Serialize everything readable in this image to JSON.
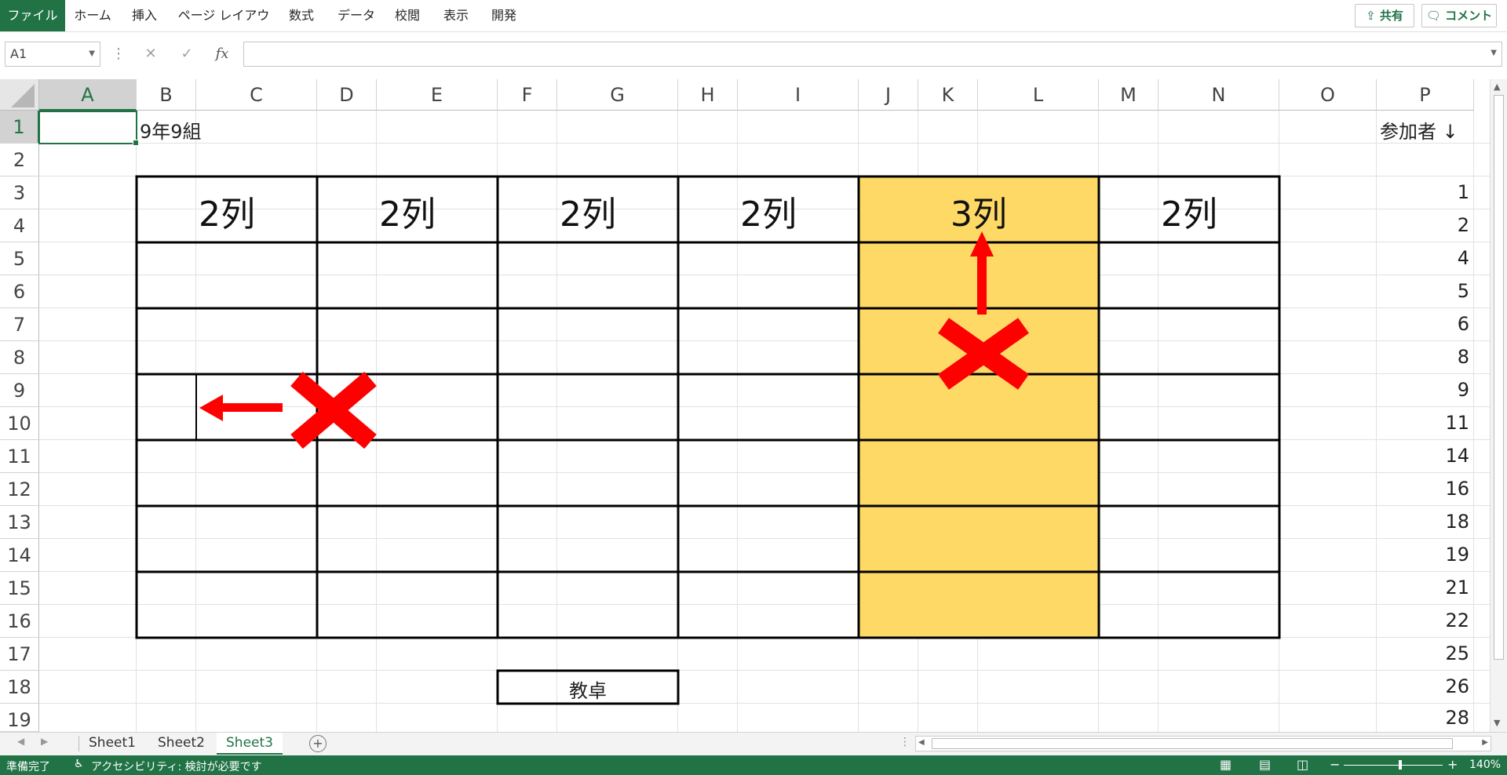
{
  "ribbon": {
    "tabs": [
      "ファイル",
      "ホーム",
      "挿入",
      "ページ レイアウト",
      "数式",
      "データ",
      "校閲",
      "表示",
      "開発"
    ],
    "share_label": "共有",
    "comment_label": "コメント"
  },
  "formula_bar": {
    "name_box": "A1",
    "cancel_icon": "✕",
    "enter_icon": "✓",
    "fx_label": "fx",
    "formula": ""
  },
  "columns": [
    "A",
    "B",
    "C",
    "D",
    "E",
    "F",
    "G",
    "H",
    "I",
    "J",
    "K",
    "L",
    "M",
    "N",
    "O",
    "P"
  ],
  "rows": [
    "1",
    "2",
    "3",
    "4",
    "5",
    "6",
    "7",
    "8",
    "9",
    "10",
    "11",
    "12",
    "13",
    "14",
    "15",
    "16",
    "17",
    "18",
    "19"
  ],
  "cells": {
    "B1": "9年9組",
    "P1": "参加者 ↓"
  },
  "seat_headers": [
    "2列",
    "2列",
    "2列",
    "2列",
    "3列",
    "2列"
  ],
  "teacher_desk": "教卓",
  "participants": [
    "1",
    "2",
    "4",
    "5",
    "6",
    "8",
    "9",
    "11",
    "14",
    "16",
    "18",
    "19",
    "21",
    "22",
    "25",
    "26",
    "28"
  ],
  "colors": {
    "excel_green": "#217346",
    "highlight": "#FFD966",
    "arrow_red": "#FF0000"
  },
  "sheets": [
    "Sheet1",
    "Sheet2",
    "Sheet3"
  ],
  "active_sheet": "Sheet3",
  "status": {
    "ready": "準備完了",
    "accessibility": "アクセシビリティ: 検討が必要です",
    "zoom": "140%"
  }
}
